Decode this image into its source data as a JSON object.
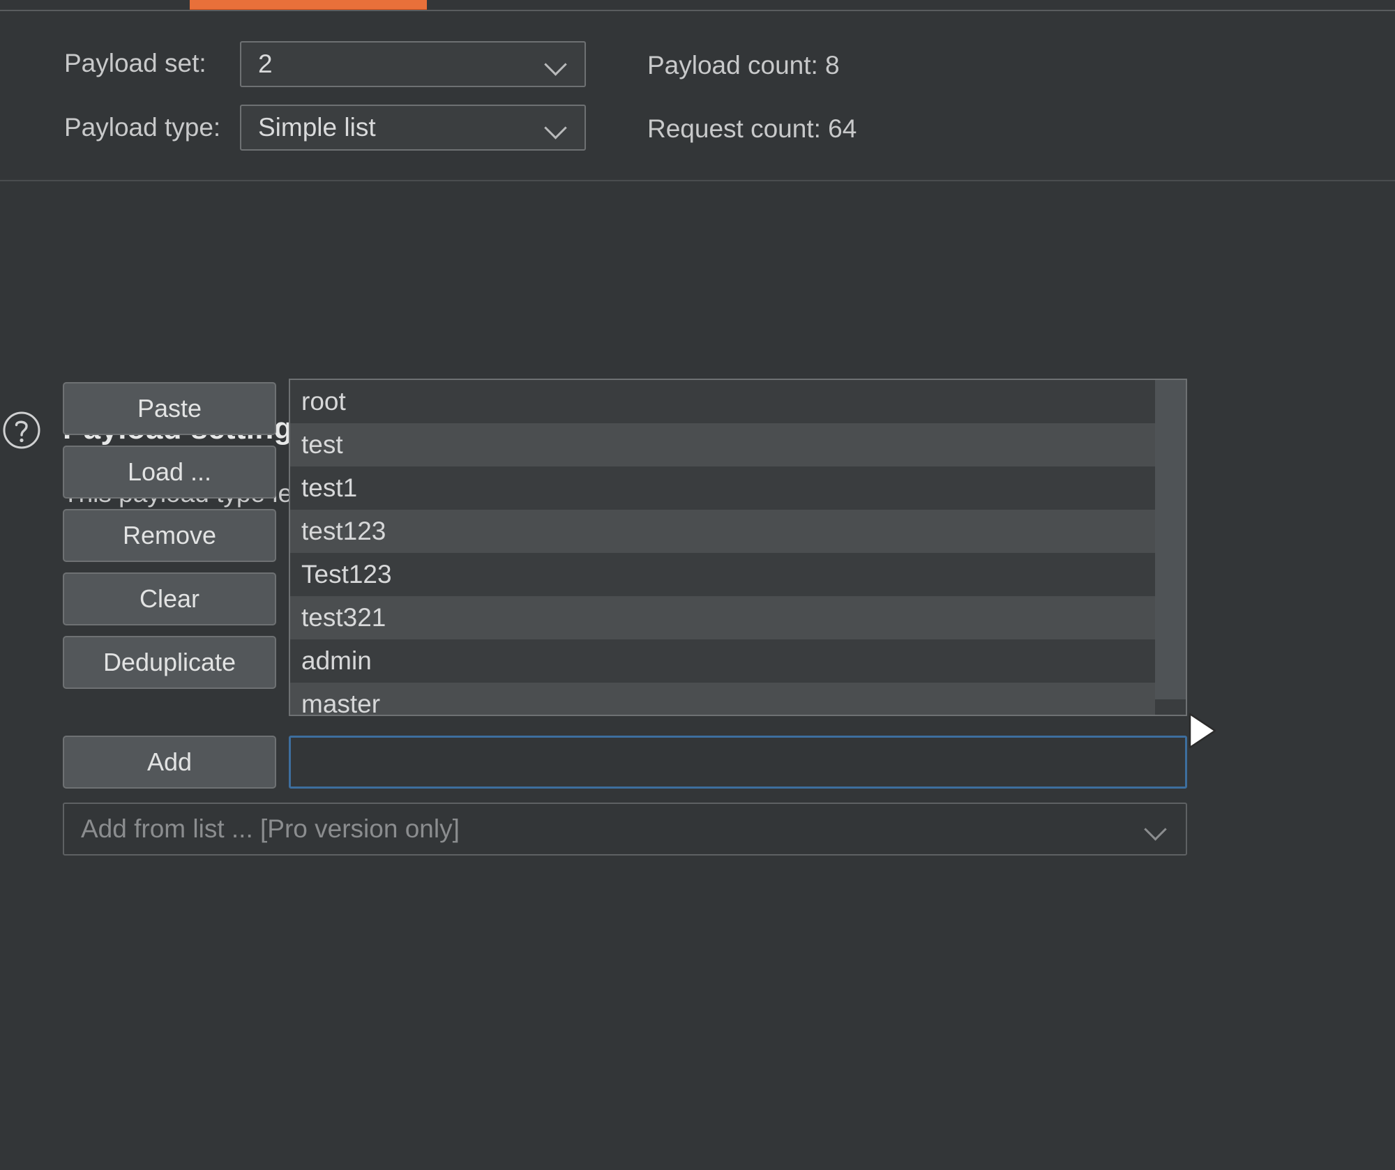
{
  "theme": {
    "background": "#333638",
    "panel": "#3c3f41",
    "accent_orange": "#e8703a",
    "focus_blue": "#3d6e9e",
    "text": "#d6d6d6",
    "muted_text": "#8b8d8f",
    "row_odd": "#3a3d3f",
    "row_even": "#4b4e50",
    "button_face": "#53575a",
    "border": "#6e7173"
  },
  "tabs": {
    "active_tab_indicator": "payloads-tab"
  },
  "config": {
    "payload_set": {
      "label": "Payload set:",
      "value": "2",
      "chevron_icon": "chevron-down-icon"
    },
    "payload_type": {
      "label": "Payload type:",
      "value": "Simple list",
      "chevron_icon": "chevron-down-icon"
    },
    "payload_count": "Payload count: 8",
    "request_count": "Request count: 64"
  },
  "panel": {
    "help_icon": "question-mark-circle-icon",
    "title": "Payload settings [Simple list]",
    "description": "This payload type lets you configure a simple list of strings that are used as payloads."
  },
  "buttons": {
    "paste": "Paste",
    "load": "Load ...",
    "remove": "Remove",
    "clear": "Clear",
    "deduplicate": "Deduplicate",
    "add": "Add"
  },
  "payload_list": {
    "items": [
      "root",
      "test",
      "test1",
      "test123",
      "Test123",
      "test321",
      "admin",
      "master"
    ],
    "scrollbar": {
      "orientation": "vertical",
      "position": "top"
    }
  },
  "add_row": {
    "input_value": "",
    "input_placeholder": ""
  },
  "add_from_list": {
    "value": "Add from list ... [Pro version only]",
    "chevron_icon": "chevron-down-icon",
    "disabled": true
  },
  "cursor": {
    "icon": "mouse-pointer-right-arrow-icon"
  }
}
